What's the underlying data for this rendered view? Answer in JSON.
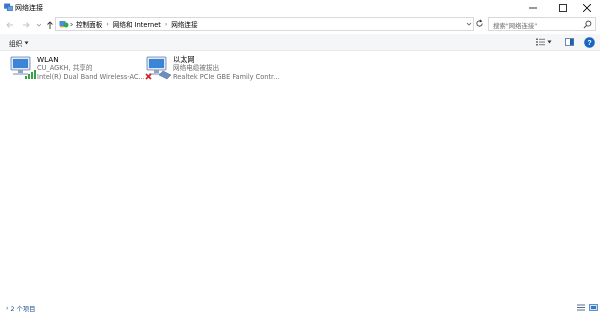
{
  "window": {
    "title": "网络连接"
  },
  "breadcrumb": [
    "控制面板",
    "网络和 Internet",
    "网络连接"
  ],
  "search": {
    "placeholder": "搜索\"网络连接\""
  },
  "toolbar": {
    "organize_label": "组织"
  },
  "items": [
    {
      "name": "WLAN",
      "line1": "CU_AGKH, 共享的",
      "line2": "Intel(R) Dual Band Wireless-AC...",
      "icon": "wifi-adapter-icon"
    },
    {
      "name": "以太网",
      "line1": "网络电缆被拔出",
      "line2": "Realtek PCIe GBE Family Contr...",
      "icon": "ethernet-adapter-disconnected-icon"
    }
  ],
  "status": {
    "items_count": "2 个项目"
  },
  "colors": {
    "accent": "#0063b1",
    "link": "#1a4c8f",
    "toolbar_bg": "#f5f6f7"
  }
}
